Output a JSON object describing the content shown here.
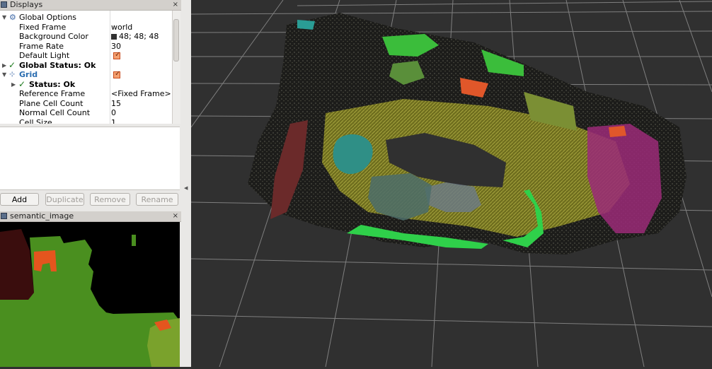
{
  "displays_panel": {
    "title": "Displays",
    "close": "×",
    "rows": [
      {
        "label": "Global Options",
        "value": ""
      },
      {
        "label": "Fixed Frame",
        "value": "world"
      },
      {
        "label": "Background Color",
        "value": "48; 48; 48"
      },
      {
        "label": "Frame Rate",
        "value": "30"
      },
      {
        "label": "Default Light",
        "value": ""
      },
      {
        "label": "Global Status: Ok",
        "value": ""
      },
      {
        "label": "Grid",
        "value": ""
      },
      {
        "label": "Status: Ok",
        "value": ""
      },
      {
        "label": "Reference Frame",
        "value": "<Fixed Frame>"
      },
      {
        "label": "Plane Cell Count",
        "value": "15"
      },
      {
        "label": "Normal Cell Count",
        "value": "0"
      },
      {
        "label": "Cell Size",
        "value": "1"
      }
    ],
    "buttons": {
      "add": "Add",
      "duplicate": "Duplicate",
      "remove": "Remove",
      "rename": "Rename"
    }
  },
  "image_panel": {
    "title": "semantic_image",
    "close": "×"
  },
  "colors": {
    "background": "#303030",
    "grid_line": "#8a8a8a",
    "accent": "#2a6db0"
  }
}
